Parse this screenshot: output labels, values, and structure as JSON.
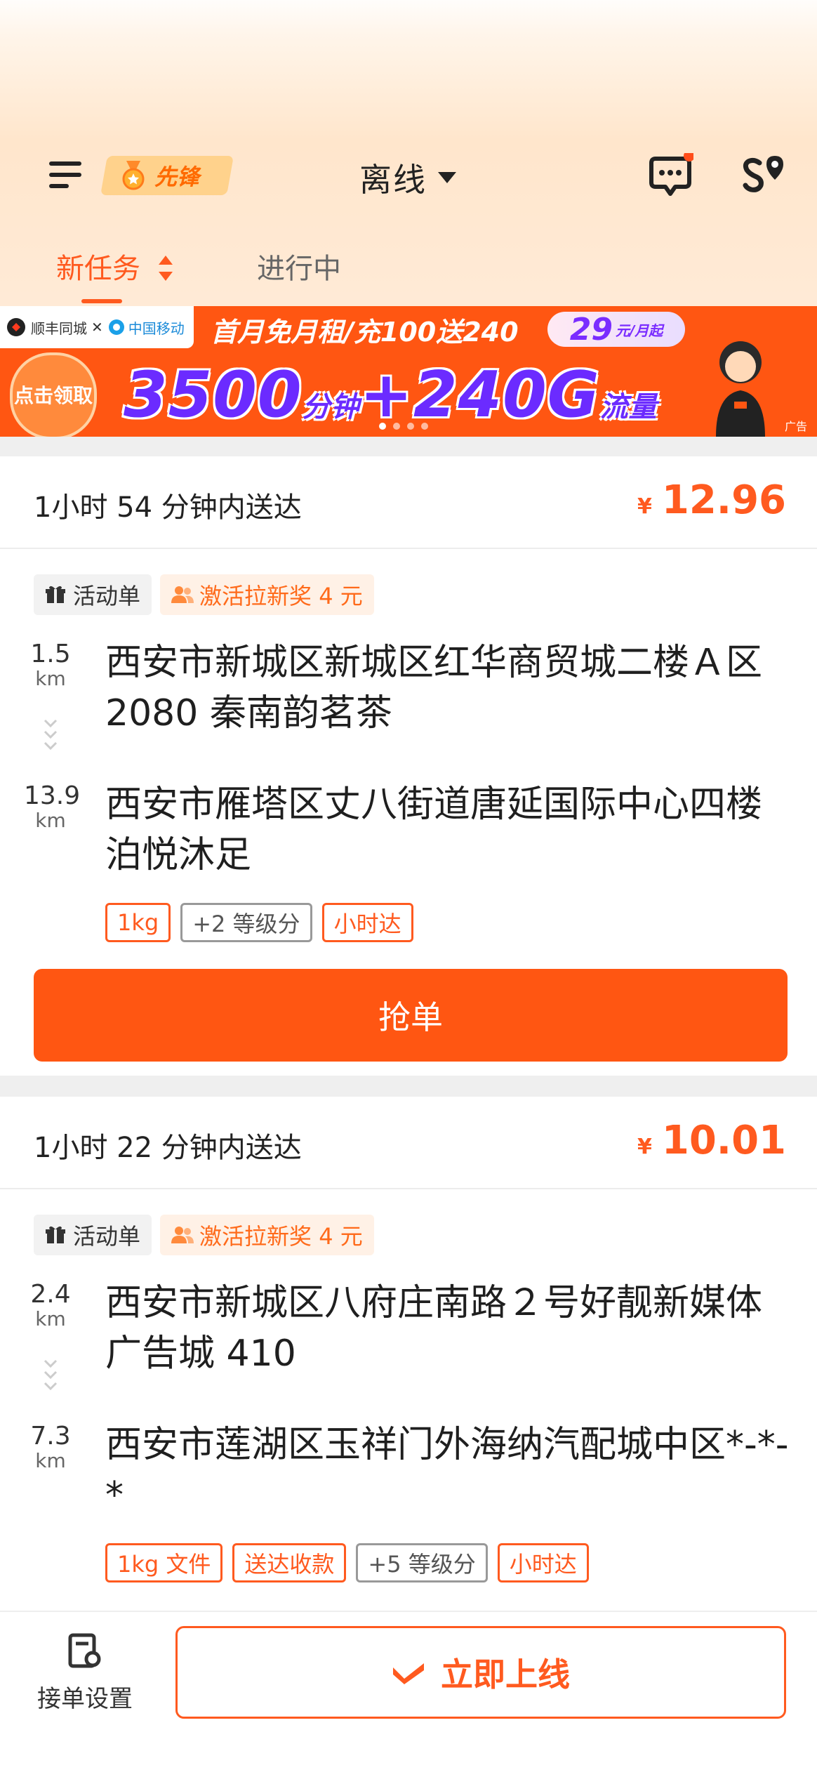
{
  "header": {
    "badge_label": "先锋",
    "status_label": "离线",
    "colors": {
      "accent": "#ff5a1f",
      "badge_bg": "#ffd28c",
      "notification_dot": "#ff4d1a"
    }
  },
  "tabs": [
    {
      "label": "新任务",
      "active": true
    },
    {
      "label": "进行中",
      "active": false
    }
  ],
  "banner": {
    "brand_left": "顺丰同城",
    "brand_right": "中国移动",
    "promo_line": "首月免月租/充100送240",
    "price": "29",
    "price_unit": "元/月起",
    "click_label": "点击领取",
    "headline_main": "3500",
    "headline_unit1": "分钟",
    "headline_plus": "+240G",
    "headline_unit2": "流量",
    "ad_label": "广告"
  },
  "orders": [
    {
      "deliver_time": "1小时 54 分钟内送达",
      "currency": "¥",
      "price": "12.96",
      "tags": [
        "活动单",
        "激活拉新奖 4 元"
      ],
      "pickup": {
        "distance": "1.5",
        "unit": "km",
        "address": "西安市新城区新城区红华商贸城二楼Ａ区 2080 秦南韵茗茶"
      },
      "dropoff": {
        "distance": "13.9",
        "unit": "km",
        "address": "西安市雁塔区丈八街道唐延国际中心四楼泊悦沐足"
      },
      "pills": [
        "1kg",
        "+2 等级分",
        "小时达"
      ],
      "grab_label": "抢单"
    },
    {
      "deliver_time": "1小时 22 分钟内送达",
      "currency": "¥",
      "price": "10.01",
      "tags": [
        "活动单",
        "激活拉新奖 4 元"
      ],
      "pickup": {
        "distance": "2.4",
        "unit": "km",
        "address": "西安市新城区八府庄南路２号好靓新媒体广告城 410"
      },
      "dropoff": {
        "distance": "7.3",
        "unit": "km",
        "address": "西安市莲湖区玉祥门外海纳汽配城中区*-*-*"
      },
      "pills": [
        "1kg 文件",
        "送达收款",
        "+5 等级分",
        "小时达"
      ]
    }
  ],
  "bottom_bar": {
    "settings_label": "接单设置",
    "online_label": "立即上线"
  }
}
